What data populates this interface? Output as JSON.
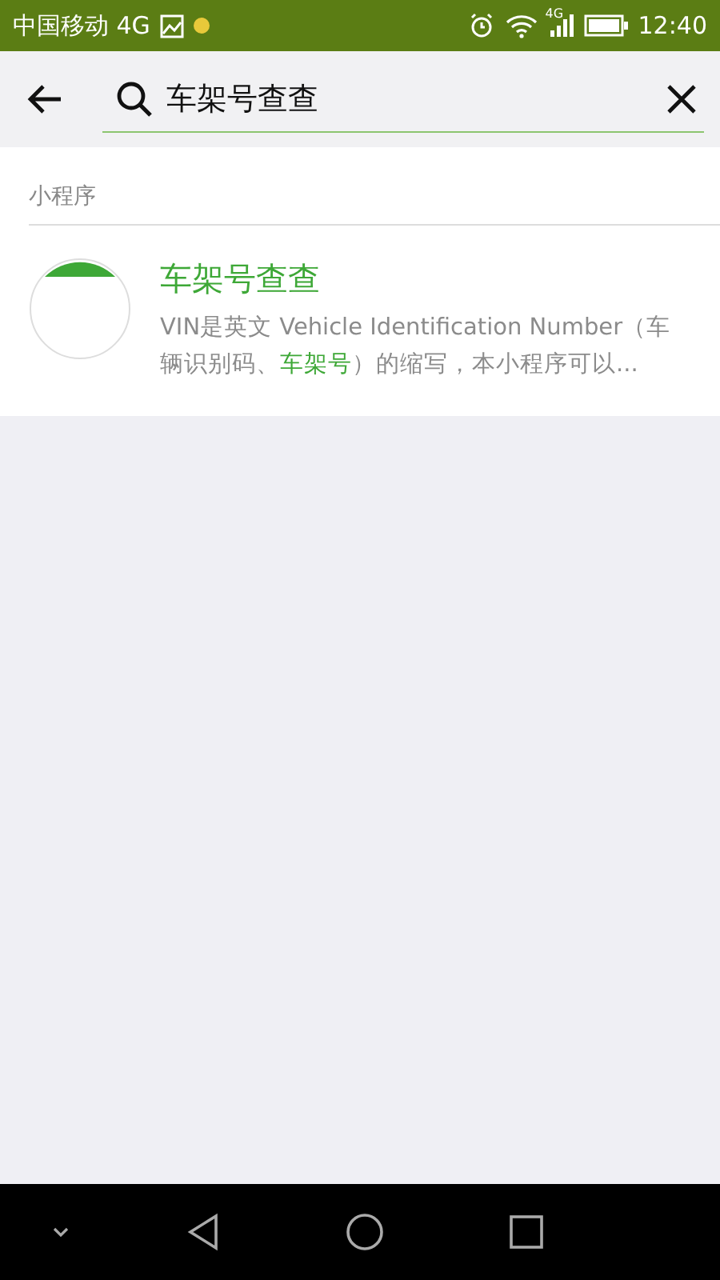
{
  "status_bar": {
    "carrier": "中国移动 4G",
    "network_badge": "4G",
    "time": "12:40"
  },
  "search": {
    "value": "车架号查查"
  },
  "section": {
    "title": "小程序",
    "results": [
      {
        "name": "车架号查查",
        "description": [
          {
            "text": "VIN是英文 Vehicle Identification Number（车辆识别码、",
            "highlight": false
          },
          {
            "text": "车架号",
            "highlight": true
          },
          {
            "text": "）的缩写，本小程序可以...",
            "highlight": false
          }
        ]
      }
    ]
  }
}
